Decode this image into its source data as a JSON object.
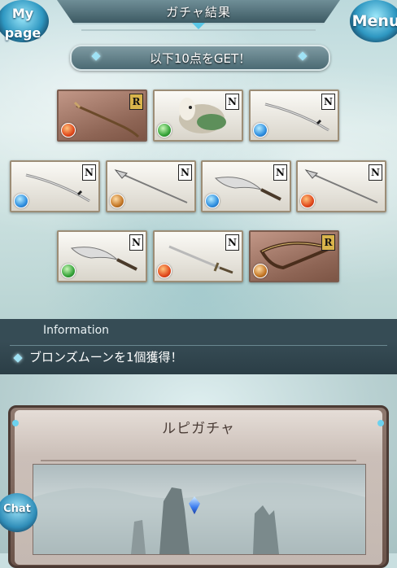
{
  "header": {
    "title": "ガチャ結果",
    "mypage_label_1": "My",
    "mypage_label_2": "page",
    "menu_label": "Menu"
  },
  "result_banner": "以下10点をGET！",
  "items": [
    {
      "rarity": "R",
      "element": "fire",
      "icon": "staff-icon"
    },
    {
      "rarity": "N",
      "element": "wind",
      "icon": "beast-summon-icon"
    },
    {
      "rarity": "N",
      "element": "water",
      "icon": "katana-icon"
    },
    {
      "rarity": "N",
      "element": "water",
      "icon": "katana-icon"
    },
    {
      "rarity": "N",
      "element": "earth",
      "icon": "spear-icon"
    },
    {
      "rarity": "N",
      "element": "water",
      "icon": "kukri-icon"
    },
    {
      "rarity": "N",
      "element": "fire",
      "icon": "spear-icon"
    },
    {
      "rarity": "N",
      "element": "wind",
      "icon": "kukri-icon"
    },
    {
      "rarity": "N",
      "element": "fire",
      "icon": "sword-icon"
    },
    {
      "rarity": "R",
      "element": "earth",
      "icon": "bow-icon"
    }
  ],
  "information": {
    "title": "Information",
    "message": "ブロンズムーンを1個獲得！"
  },
  "gacha_panel": {
    "title": "ルピガチャ"
  },
  "chat": {
    "label": "Chat"
  },
  "colors": {
    "accent": "#58c6e6",
    "rare_card": "#8e6555",
    "info_bar": "#2b3e46"
  }
}
